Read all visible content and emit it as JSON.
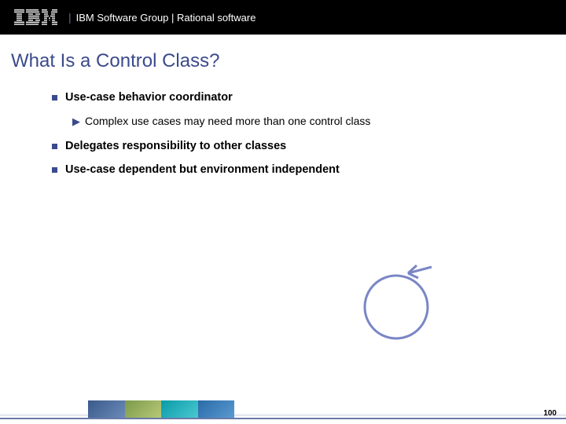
{
  "header": {
    "text": "IBM Software Group | Rational software"
  },
  "title": "What Is a Control Class?",
  "bullets": [
    {
      "text": "Use-case behavior coordinator",
      "sub": "Complex use cases may need more than one control class"
    },
    {
      "text": "Delegates responsibility to other classes"
    },
    {
      "text": "Use-case dependent but environment independent"
    }
  ],
  "pageNumber": "100"
}
